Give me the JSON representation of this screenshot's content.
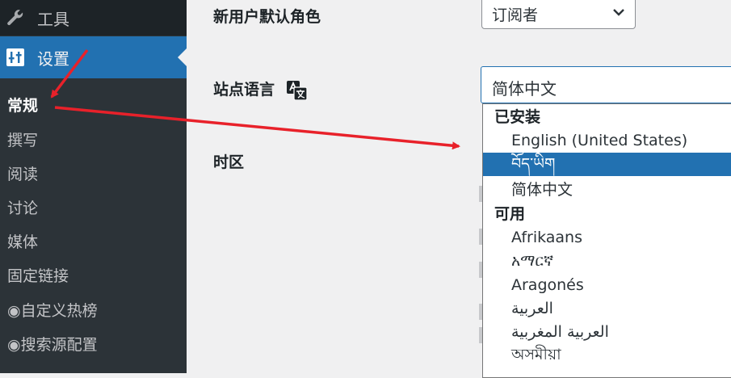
{
  "sidebar": {
    "tools_label": "工具",
    "settings_label": "设置",
    "submenu": [
      "常规",
      "撰写",
      "阅读",
      "讨论",
      "媒体",
      "固定链接",
      "◉自定义热榜",
      "◉搜索源配置"
    ]
  },
  "main": {
    "default_role_label": "新用户默认角色",
    "default_role_value": "订阅者",
    "site_language_label": "站点语言",
    "site_language_value": "简体中文",
    "timezone_label": "时区"
  },
  "dropdown": {
    "group_installed": "已安装",
    "installed": [
      "English (United States)",
      "བོད་ཡིག",
      "简体中文"
    ],
    "group_available": "可用",
    "available": [
      "Afrikaans",
      "አማርኛ",
      "Aragonés",
      "العربية",
      "العربية المغربية",
      "অসমীয়া"
    ]
  },
  "colors": {
    "sidebar_bg": "#2c3338",
    "active_menu": "#2271b1",
    "annotation_arrow": "#e8212a"
  }
}
